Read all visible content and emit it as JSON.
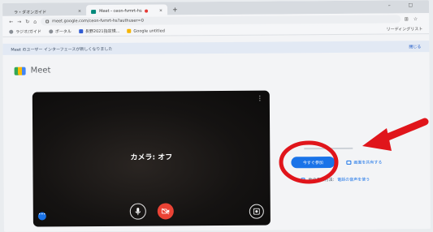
{
  "browser": {
    "tabs": [
      {
        "label": "ラ・ダオンガイド",
        "active": false
      },
      {
        "label": "Meet - ceon-fvmrt-hs",
        "active": true,
        "recording": true
      }
    ],
    "new_tab": "+",
    "window_controls": "– ☐",
    "url": "meet.google.com/ceon-fvmrt-hs?authuser=0",
    "bookmarks": [
      {
        "label": "ラジオ/ガイド",
        "icon": "globe-icon"
      },
      {
        "label": "ポータル",
        "icon": "globe-icon"
      },
      {
        "label": "長野2021指定規...",
        "icon": "doc-icon"
      },
      {
        "label": "Google untitled",
        "icon": "folder-icon"
      }
    ],
    "bookmarks_right": "リーディングリスト"
  },
  "notice": {
    "text": "Meet のユーザー インターフェースが新しくなりました",
    "dismiss": "閉じる"
  },
  "logo": {
    "text": "Meet"
  },
  "preview": {
    "status": "カメラ: オフ",
    "more": "⋮"
  },
  "join": {
    "join_label": "今すぐ参加",
    "present_label": "画面を共有する",
    "other_prefix": "他の参加方法:",
    "other_link": "電話の音声を使う"
  },
  "colors": {
    "join_button": "#1a73e8",
    "camera_off_button": "#ea4335",
    "annotation": "#e0151b"
  }
}
